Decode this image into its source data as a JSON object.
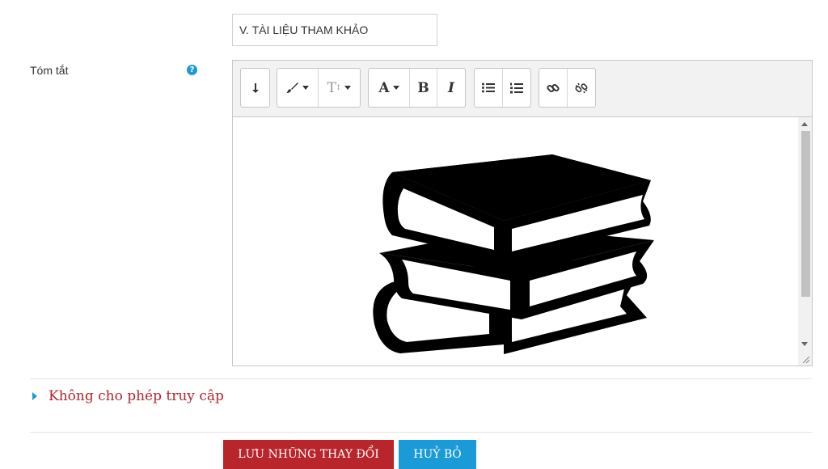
{
  "form": {
    "name_value": "V. TÀI LIỆU THAM KHẢO",
    "summary_label": "Tóm tắt",
    "help_icon": "question-circle-icon",
    "help_symbol": "?"
  },
  "editor": {
    "toolbar": {
      "groups": [
        [
          "toolbar-toggle-icon"
        ],
        [
          "brush-icon",
          "font-size-icon"
        ],
        [
          "font-color-icon",
          "bold-icon",
          "italic-icon"
        ],
        [
          "unordered-list-icon",
          "ordered-list-icon"
        ],
        [
          "link-icon",
          "unlink-icon"
        ]
      ],
      "bold_label": "B",
      "italic_label": "I",
      "font_color_label": "A",
      "font_size_label": "T"
    },
    "content_image": "stacked-books-icon"
  },
  "restrict_access": {
    "label": "Không cho phép truy cập"
  },
  "buttons": {
    "save_label": "LƯU NHỮNG THAY ĐỔI",
    "cancel_label": "HUỶ BỎ"
  },
  "colors": {
    "accent_red": "#b8252b",
    "accent_blue": "#1a9bd7"
  }
}
